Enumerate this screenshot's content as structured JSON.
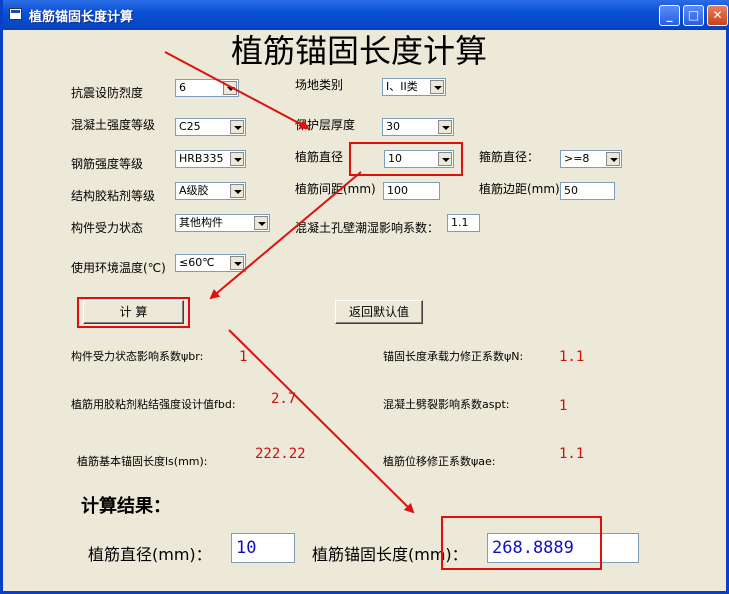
{
  "window": {
    "title": "植筋锚固长度计算",
    "buttons": {
      "minimize": "_",
      "maximize": "□",
      "close": "✕"
    }
  },
  "form": {
    "heading": "植筋锚固长度计算",
    "seismic": {
      "label": "抗震设防烈度",
      "value": "6"
    },
    "site_class": {
      "label": "场地类别",
      "value": "I、II类"
    },
    "concrete": {
      "label": "混凝土强度等级",
      "value": "C25"
    },
    "cover": {
      "label": "保护层厚度",
      "value": "30"
    },
    "rebar_grade": {
      "label": "钢筋强度等级",
      "value": "HRB335"
    },
    "rebar_diameter": {
      "label": "植筋直径",
      "value": "10"
    },
    "stirrup": {
      "label": "箍筋直径：",
      "value": ">=8"
    },
    "adhesive": {
      "label": "结构胶粘剂等级",
      "value": "A级胶"
    },
    "spacing": {
      "label": "植筋间距(mm)",
      "value": "100"
    },
    "edge": {
      "label": "植筋边距(mm)",
      "value": "50"
    },
    "stress_state": {
      "label": "构件受力状态",
      "value": "其他构件"
    },
    "humidity": {
      "label": "混凝土孔壁潮湿影响系数：",
      "value": "1.1"
    },
    "temperature": {
      "label": "使用环境温度(℃)",
      "value": "≤60℃"
    },
    "calc_button": "计   算",
    "reset_button": "返回默认值"
  },
  "coefficients": {
    "psi_br": {
      "label": "构件受力状态影响系数ψbr:",
      "value": "1"
    },
    "psi_n": {
      "label": "锚固长度承载力修正系数ψN:",
      "value": "1.1"
    },
    "fbd": {
      "label": "植筋用胶粘剂粘结强度设计值fbd:",
      "value": "2.7"
    },
    "aspt": {
      "label": "混凝土劈裂影响系数aspt:",
      "value": "1"
    },
    "ls": {
      "label": "植筋基本锚固长度ls(mm):",
      "value": "222.22"
    },
    "psi_ae": {
      "label": "植筋位移修正系数ψae:",
      "value": "1.1"
    }
  },
  "result": {
    "title": "计算结果：",
    "diameter_label": "植筋直径(mm)：",
    "diameter_value": "10",
    "length_label": "植筋锚固长度(mm)：",
    "length_value": "268.8889"
  },
  "colors": {
    "annotation": "#e01010",
    "result_text": "#1010c0"
  }
}
